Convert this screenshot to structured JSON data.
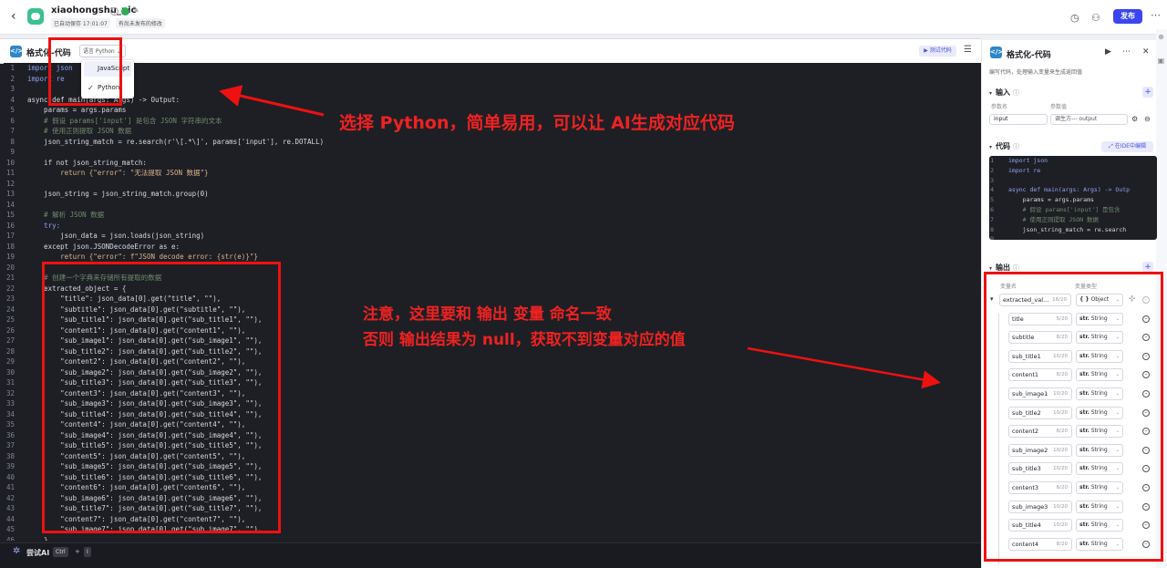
{
  "app": {
    "title": "xiaohongshu_pic",
    "autosave": "已自动保存 17:01:07",
    "unpublished": "有尚未发布的修改",
    "publish_label": "发布"
  },
  "editor": {
    "title": "格式化-代码",
    "lang_select": "语言 Python",
    "test_label": "测试代码",
    "lang_options": [
      "JavaScript",
      "Python"
    ],
    "selected_lang": "Python",
    "code_lines": [
      {
        "n": "1",
        "t": "import json",
        "c": "kw"
      },
      {
        "n": "2",
        "t": "import re",
        "c": "kw"
      },
      {
        "n": "3",
        "t": "",
        "c": ""
      },
      {
        "n": "4",
        "t": "async def main(args: Args) -> Output:",
        "c": ""
      },
      {
        "n": "5",
        "t": "    params = args.params",
        "c": ""
      },
      {
        "n": "6",
        "t": "    # 假设 params['input'] 是包含 JSON 字符串的文本",
        "c": "cm"
      },
      {
        "n": "7",
        "t": "    # 使用正则提取 JSON 数据",
        "c": "cm"
      },
      {
        "n": "8",
        "t": "    json_string_match = re.search(r'\\[.*\\]', params['input'], re.DOTALL)",
        "c": ""
      },
      {
        "n": "9",
        "t": "",
        "c": ""
      },
      {
        "n": "10",
        "t": "    if not json_string_match:",
        "c": ""
      },
      {
        "n": "11",
        "t": "        return {\"error\": \"无法提取 JSON 数据\"}",
        "c": "er"
      },
      {
        "n": "12",
        "t": "",
        "c": ""
      },
      {
        "n": "13",
        "t": "    json_string = json_string_match.group(0)",
        "c": ""
      },
      {
        "n": "14",
        "t": "",
        "c": ""
      },
      {
        "n": "15",
        "t": "    # 解析 JSON 数据",
        "c": "cm"
      },
      {
        "n": "16",
        "t": "    try:",
        "c": "kw"
      },
      {
        "n": "17",
        "t": "        json_data = json.loads(json_string)",
        "c": ""
      },
      {
        "n": "18",
        "t": "    except json.JSONDecodeError as e:",
        "c": ""
      },
      {
        "n": "19",
        "t": "        return {\"error\": f\"JSON decode error: {str(e)}\"}",
        "c": "er"
      },
      {
        "n": "20",
        "t": "",
        "c": ""
      },
      {
        "n": "21",
        "t": "    # 创建一个字典来存储所有提取的数据",
        "c": "cm"
      },
      {
        "n": "22",
        "t": "    extracted_object = {",
        "c": ""
      },
      {
        "n": "23",
        "t": "        \"title\": json_data[0].get(\"title\", \"\"),",
        "c": ""
      },
      {
        "n": "24",
        "t": "        \"subtitle\": json_data[0].get(\"subtitle\", \"\"),",
        "c": ""
      },
      {
        "n": "25",
        "t": "        \"sub_title1\": json_data[0].get(\"sub_title1\", \"\"),",
        "c": ""
      },
      {
        "n": "26",
        "t": "        \"content1\": json_data[0].get(\"content1\", \"\"),",
        "c": ""
      },
      {
        "n": "27",
        "t": "        \"sub_image1\": json_data[0].get(\"sub_image1\", \"\"),",
        "c": ""
      },
      {
        "n": "28",
        "t": "        \"sub_title2\": json_data[0].get(\"sub_title2\", \"\"),",
        "c": ""
      },
      {
        "n": "29",
        "t": "        \"content2\": json_data[0].get(\"content2\", \"\"),",
        "c": ""
      },
      {
        "n": "30",
        "t": "        \"sub_image2\": json_data[0].get(\"sub_image2\", \"\"),",
        "c": ""
      },
      {
        "n": "31",
        "t": "        \"sub_title3\": json_data[0].get(\"sub_title3\", \"\"),",
        "c": ""
      },
      {
        "n": "32",
        "t": "        \"content3\": json_data[0].get(\"content3\", \"\"),",
        "c": ""
      },
      {
        "n": "33",
        "t": "        \"sub_image3\": json_data[0].get(\"sub_image3\", \"\"),",
        "c": ""
      },
      {
        "n": "34",
        "t": "        \"sub_title4\": json_data[0].get(\"sub_title4\", \"\"),",
        "c": ""
      },
      {
        "n": "35",
        "t": "        \"content4\": json_data[0].get(\"content4\", \"\"),",
        "c": ""
      },
      {
        "n": "36",
        "t": "        \"sub_image4\": json_data[0].get(\"sub_image4\", \"\"),",
        "c": ""
      },
      {
        "n": "37",
        "t": "        \"sub_title5\": json_data[0].get(\"sub_title5\", \"\"),",
        "c": ""
      },
      {
        "n": "38",
        "t": "        \"content5\": json_data[0].get(\"content5\", \"\"),",
        "c": ""
      },
      {
        "n": "39",
        "t": "        \"sub_image5\": json_data[0].get(\"sub_image5\", \"\"),",
        "c": ""
      },
      {
        "n": "40",
        "t": "        \"sub_title6\": json_data[0].get(\"sub_title6\", \"\"),",
        "c": ""
      },
      {
        "n": "41",
        "t": "        \"content6\": json_data[0].get(\"content6\", \"\"),",
        "c": ""
      },
      {
        "n": "42",
        "t": "        \"sub_image6\": json_data[0].get(\"sub_image6\", \"\"),",
        "c": ""
      },
      {
        "n": "43",
        "t": "        \"sub_title7\": json_data[0].get(\"sub_title7\", \"\"),",
        "c": ""
      },
      {
        "n": "44",
        "t": "        \"content7\": json_data[0].get(\"content7\", \"\"),",
        "c": ""
      },
      {
        "n": "45",
        "t": "        \"sub_image7\": json_data[0].get(\"sub_image7\", \"\"),",
        "c": ""
      },
      {
        "n": "46",
        "t": "    }",
        "c": ""
      }
    ],
    "ai_label": "尝试AI",
    "shortcut": [
      "Ctrl",
      "I"
    ]
  },
  "side": {
    "title": "格式化-代码",
    "desc": "编写代码，处理输入变量来生成返回值",
    "input_label": "输入",
    "param_name_hdr": "参数名",
    "param_value_hdr": "参数值",
    "input_name": "input",
    "input_value": "调生方--- output",
    "code_label": "代码",
    "ide_label": "在IDE中编辑",
    "mini_code": [
      {
        "n": "1",
        "t": "import json",
        "c": "kw"
      },
      {
        "n": "2",
        "t": "import re",
        "c": "kw"
      },
      {
        "n": "3",
        "t": "",
        "c": ""
      },
      {
        "n": "4",
        "t": "async def main(args: Args) -> Outp",
        "c": "kw"
      },
      {
        "n": "5",
        "t": "    params = args.params",
        "c": ""
      },
      {
        "n": "6",
        "t": "    # 假设 params['input'] 是包含",
        "c": "cm"
      },
      {
        "n": "7",
        "t": "    # 使用正则提取 JSON 数据",
        "c": "cm"
      },
      {
        "n": "8",
        "t": "    json_string_match = re.search",
        "c": ""
      },
      {
        "n": "9",
        "t": "",
        "c": ""
      }
    ],
    "output_label": "输出",
    "var_name_hdr": "变量名",
    "var_type_hdr": "变量类型",
    "outputs": [
      {
        "name": "extracted_val...",
        "count": "16/20",
        "type": "Object",
        "sym": "{ }"
      },
      {
        "name": "title",
        "count": "5/20",
        "type": "String",
        "sym": "str."
      },
      {
        "name": "subtitle",
        "count": "8/20",
        "type": "String",
        "sym": "str."
      },
      {
        "name": "sub_title1",
        "count": "10/20",
        "type": "String",
        "sym": "str."
      },
      {
        "name": "content1",
        "count": "8/20",
        "type": "String",
        "sym": "str."
      },
      {
        "name": "sub_image1",
        "count": "10/20",
        "type": "String",
        "sym": "str."
      },
      {
        "name": "sub_title2",
        "count": "10/20",
        "type": "String",
        "sym": "str."
      },
      {
        "name": "content2",
        "count": "8/20",
        "type": "String",
        "sym": "str."
      },
      {
        "name": "sub_image2",
        "count": "10/20",
        "type": "String",
        "sym": "str."
      },
      {
        "name": "sub_title3",
        "count": "10/20",
        "type": "String",
        "sym": "str."
      },
      {
        "name": "content3",
        "count": "8/20",
        "type": "String",
        "sym": "str."
      },
      {
        "name": "sub_image3",
        "count": "10/20",
        "type": "String",
        "sym": "str."
      },
      {
        "name": "sub_title4",
        "count": "10/20",
        "type": "String",
        "sym": "str."
      },
      {
        "name": "content4",
        "count": "8/20",
        "type": "String",
        "sym": "str."
      }
    ]
  },
  "annotations": {
    "note1": "选择 Python，简单易用，可以让 AI生成对应代码",
    "note2a": "注意，这里要和 输出 变量 命名一致",
    "note2b": "否则 输出结果为 null，获取不到变量对应的值",
    "color": "#ee2222"
  }
}
